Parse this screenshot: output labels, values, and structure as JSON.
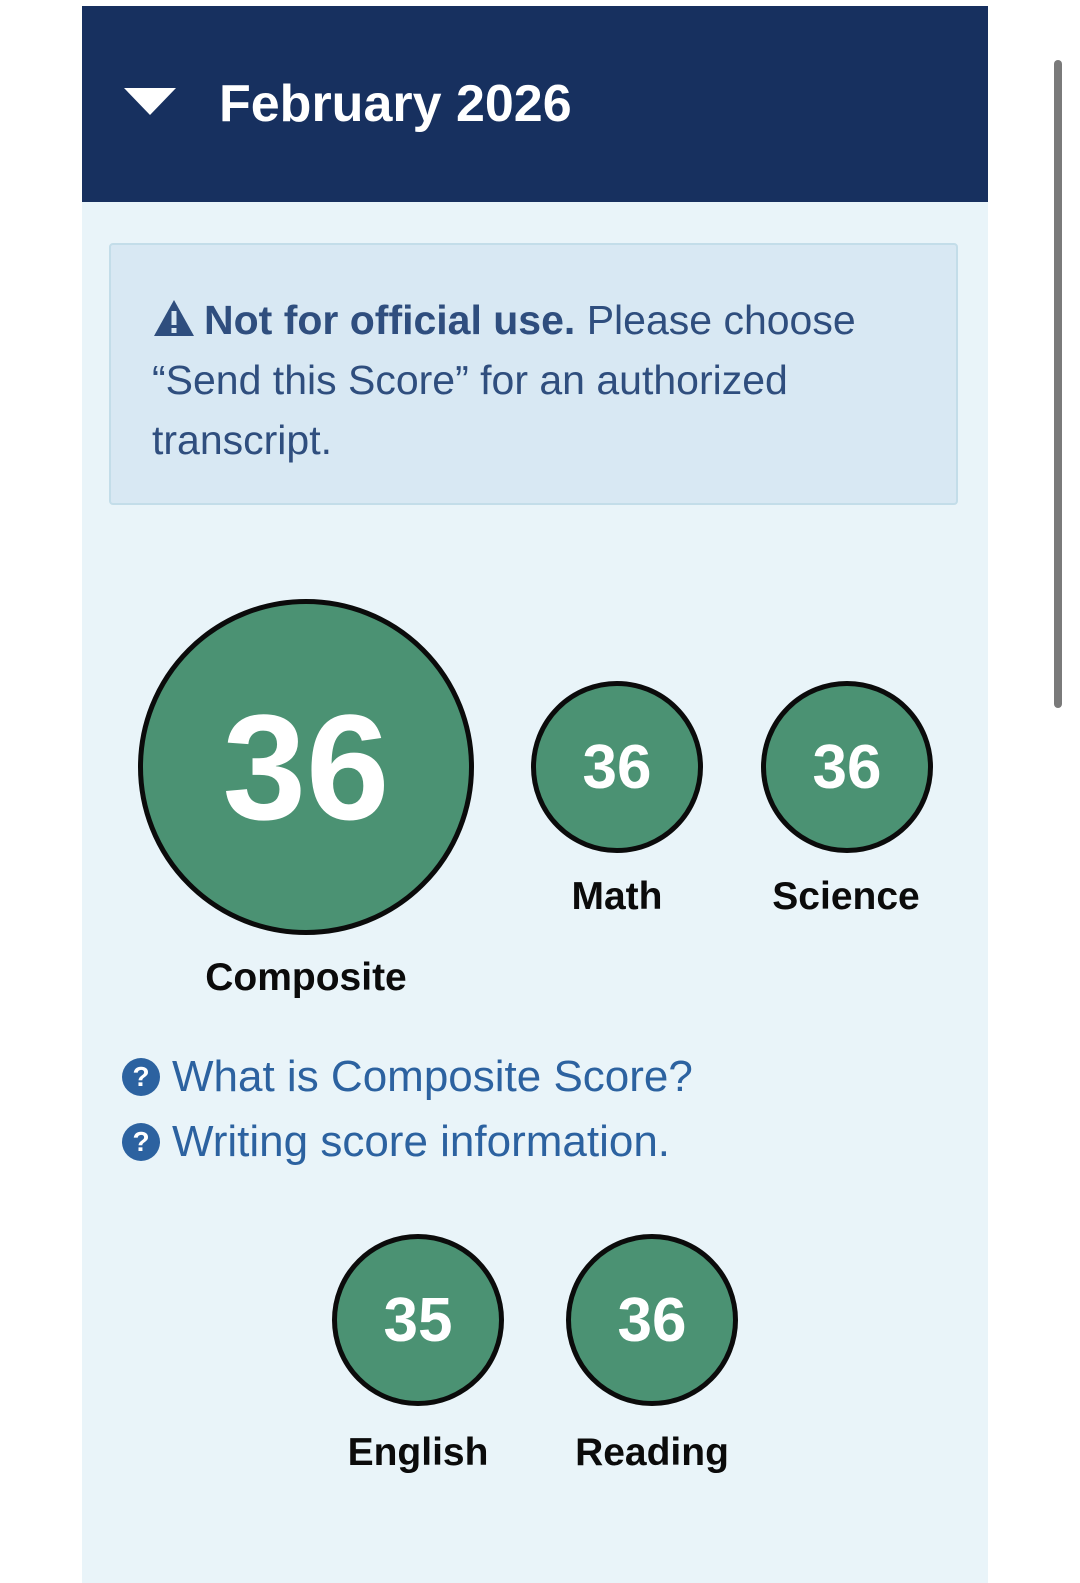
{
  "header": {
    "title": "February 2026",
    "toggle_icon": "caret-down-icon"
  },
  "alert": {
    "icon": "warning-icon",
    "strong": "Not for official use.",
    "text": " Please choose “Send this Score” for an authorized transcript."
  },
  "scores": {
    "composite": {
      "value": "36",
      "label": "Composite"
    },
    "math": {
      "value": "36",
      "label": "Math"
    },
    "science": {
      "value": "36",
      "label": "Science"
    },
    "english": {
      "value": "35",
      "label": "English"
    },
    "reading": {
      "value": "36",
      "label": "Reading"
    }
  },
  "help_links": [
    {
      "icon": "question-circle-icon",
      "text": "What is Composite Score?"
    },
    {
      "icon": "question-circle-icon",
      "text": "Writing score information."
    }
  ],
  "colors": {
    "header_bg": "#17305f",
    "panel_bg": "#e9f4f9",
    "score_circle": "#4b9273",
    "link": "#2c62a0"
  }
}
